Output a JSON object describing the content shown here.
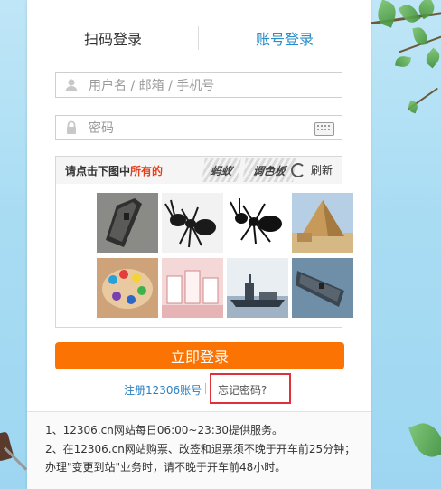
{
  "tabs": {
    "qr_login": "扫码登录",
    "account_login": "账号登录"
  },
  "form": {
    "username_placeholder": "用户名 / 邮箱 / 手机号",
    "password_placeholder": "密码"
  },
  "captcha": {
    "prompt_prefix": "请点击下图中",
    "prompt_highlight": "所有的",
    "word1": "蚂蚁",
    "word2": "调色板",
    "refresh_label": "刷新",
    "tiles": [
      "aircraft-carrier",
      "ant",
      "ant",
      "pyramid",
      "color-palette",
      "cups",
      "aircraft-carrier",
      "aircraft-carrier"
    ]
  },
  "actions": {
    "login_label": "立即登录",
    "register_label": "注册12306账号",
    "forgot_label": "忘记密码?"
  },
  "notes": {
    "line1": "1、12306.cn网站每日06:00~23:30提供服务。",
    "line2": "2、在12306.cn网站购票、改签和退票须不晚于开车前25分钟；办理\"变更到站\"业务时，请不晚于开车前48小时。"
  },
  "colors": {
    "accent_blue": "#2a8ec8",
    "login_orange": "#fb7403",
    "highlight_red": "#e0303a"
  }
}
